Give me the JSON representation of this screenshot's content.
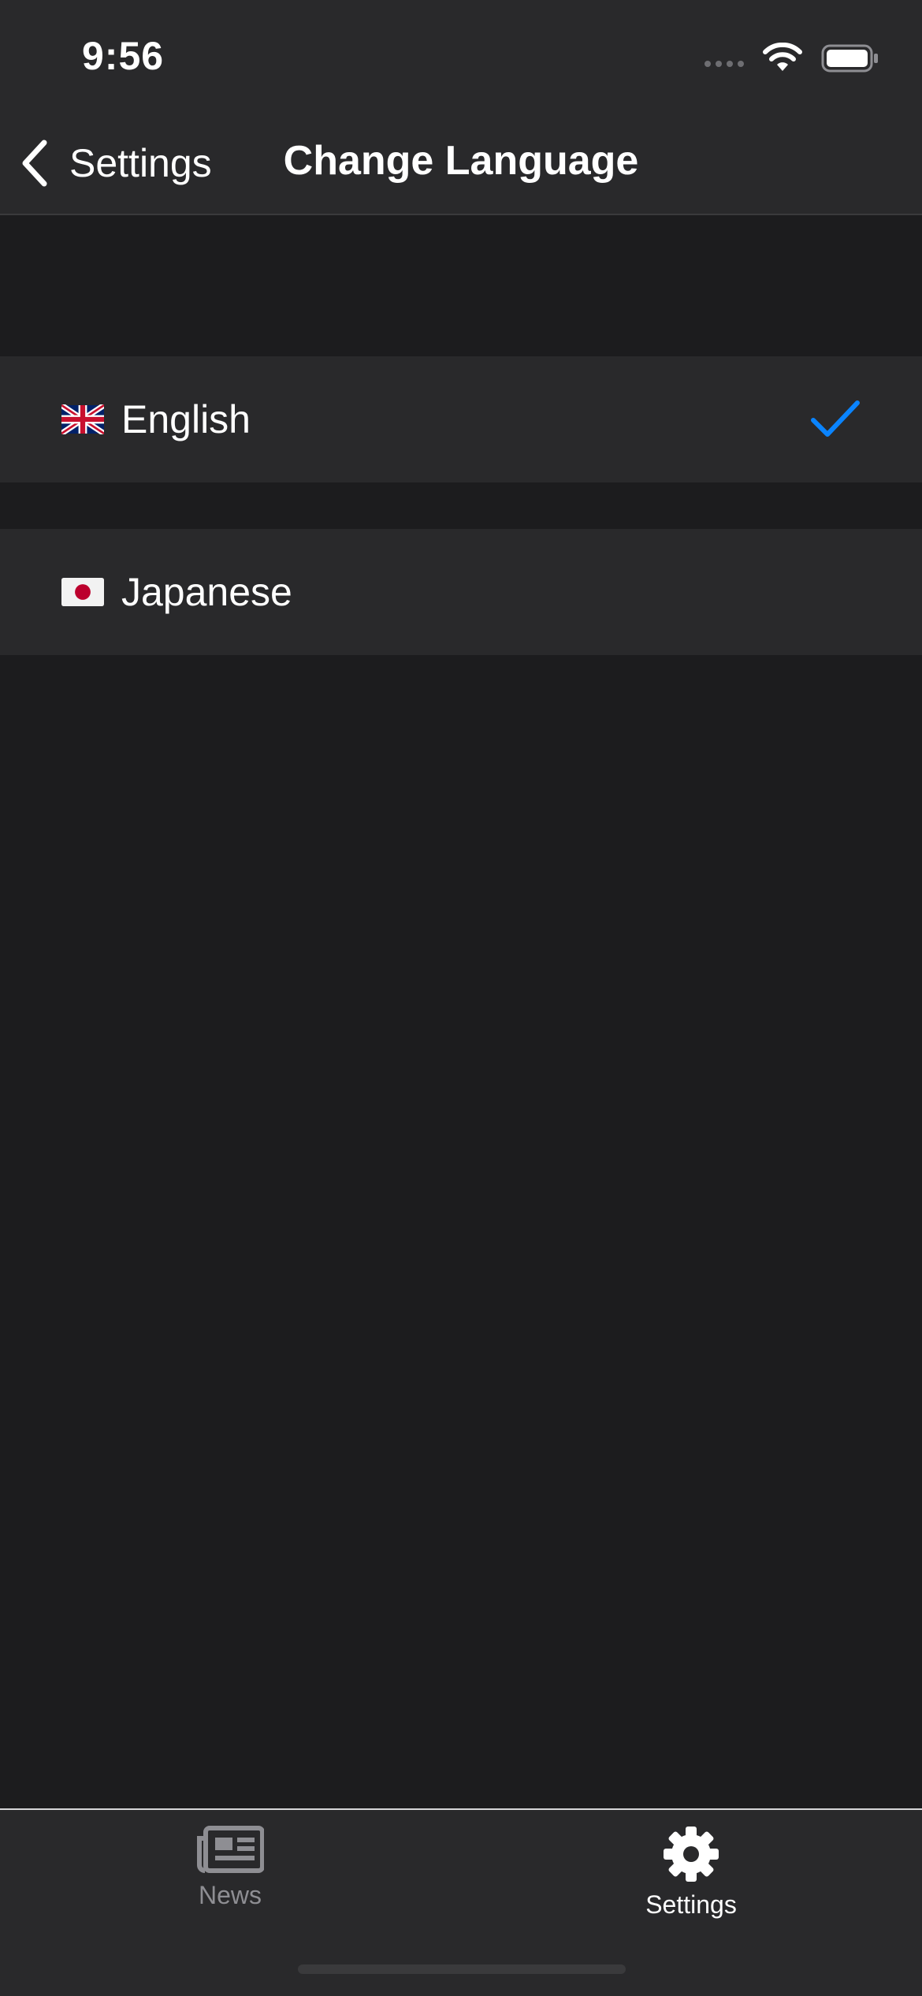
{
  "status_bar": {
    "time": "9:56"
  },
  "nav": {
    "back_label": "Settings",
    "title": "Change Language"
  },
  "languages": [
    {
      "label": "English",
      "flag": "uk-flag-icon",
      "selected": true
    },
    {
      "label": "Japanese",
      "flag": "japan-flag-icon",
      "selected": false
    }
  ],
  "tabbar": {
    "tabs": [
      {
        "label": "News",
        "icon": "newspaper-icon",
        "active": false
      },
      {
        "label": "Settings",
        "icon": "gear-icon",
        "active": true
      }
    ]
  },
  "colors": {
    "background": "#1c1c1e",
    "row_background": "#29292b",
    "accent": "#0a84ff",
    "inactive_tab": "#8e8e93"
  }
}
